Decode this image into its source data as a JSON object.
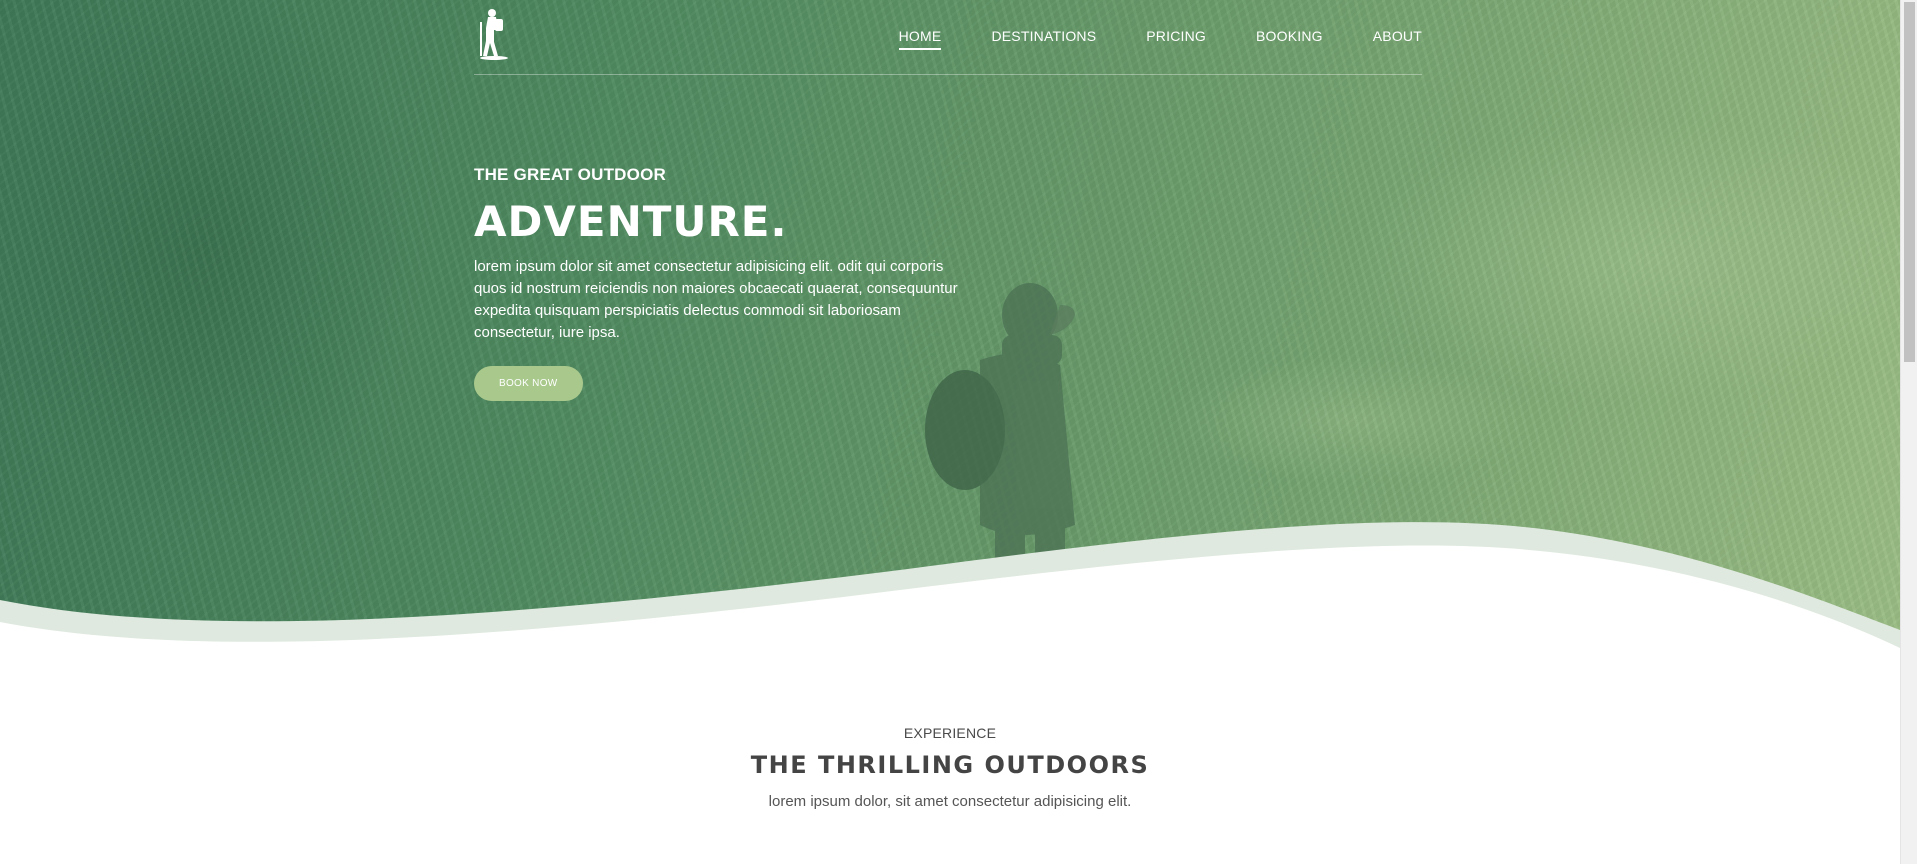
{
  "nav": {
    "items": [
      {
        "label": "HOME",
        "active": true
      },
      {
        "label": "DESTINATIONS",
        "active": false
      },
      {
        "label": "PRICING",
        "active": false
      },
      {
        "label": "BOOKING",
        "active": false
      },
      {
        "label": "ABOUT",
        "active": false
      }
    ],
    "logo_icon": "hiker-logo-icon"
  },
  "hero": {
    "eyebrow": "THE GREAT OUTDOOR",
    "headline": "ADVENTURE.",
    "lead": "lorem ipsum dolor sit amet consectetur adipisicing elit. odit qui corporis quos id nostrum reiciendis non maiores obcaecati quaerat, consequuntur expedita quisquam perspiciatis delectus commodi sit laboriosam consectetur, iure ipsa.",
    "cta_label": "BOOK NOW"
  },
  "section": {
    "eyebrow": "EXPERIENCE",
    "title": "THE THRILLING OUTDOORS",
    "subtitle": "lorem ipsum dolor, sit amet consectetur adipisicing elit."
  },
  "colors": {
    "hero_green_dark": "#3f7a58",
    "hero_green_light": "#9dbf86",
    "button": "#a8c88c",
    "text_dark": "#444444"
  }
}
